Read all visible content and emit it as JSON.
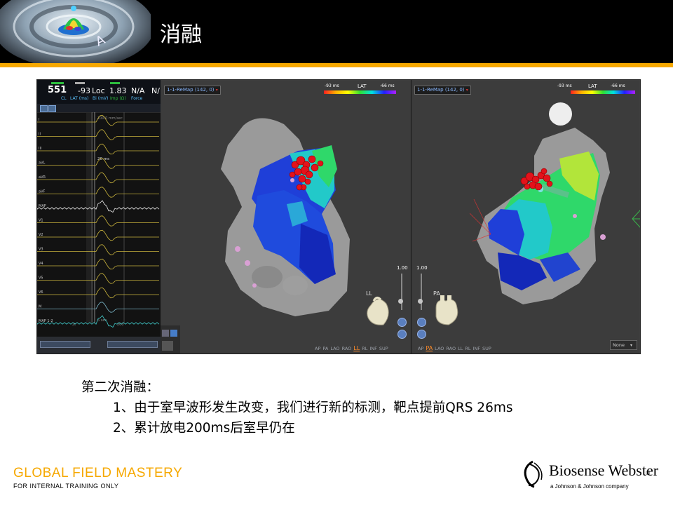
{
  "slide": {
    "title": "消融",
    "body_heading": "第二次消融：",
    "body_line_1": "1、由于室早波形发生改变，我们进行新的标测，靶点提前QRS 26ms",
    "body_line_2": "2、累计放电200ms后室早仍在"
  },
  "footer": {
    "program": "GLOBAL  FIELD  MASTERY",
    "disclaimer": "FOR INTERNAL  TRAINING  ONLY",
    "brand": "Biosense Webster",
    "brand_mark": "®",
    "brand_sub": "a Johnson & Johnson company"
  },
  "ecg": {
    "readouts": [
      {
        "value": "551",
        "label": "CL"
      },
      {
        "value": "-93",
        "label": "LAT (ms)"
      },
      {
        "value": "Loc",
        "label": "Bi (mV)"
      },
      {
        "value": "1.83",
        "label": "Imp (Ω)"
      },
      {
        "value": "N/A",
        "label": "Force"
      },
      {
        "value": "N/",
        "label": ""
      }
    ],
    "speed_label": "100.0 mm/sec",
    "interval_label": "26 ms",
    "time_label_left": "2t",
    "time_label_mid": "5 sec",
    "time_label_right": "200",
    "leads": [
      "I",
      "II",
      "III",
      "aVL",
      "aVR",
      "aVF",
      "MAP",
      "V1",
      "V2",
      "V3",
      "V4",
      "V5",
      "V6",
      "M",
      "MAP 1-2"
    ]
  },
  "map_left": {
    "map_selector": "1-1-ReMap (142, 0)",
    "lat_title": "LAT",
    "lat_min": "-93 ms",
    "lat_max": "-66 ms",
    "slider_value": "1.00",
    "orientation": "LL",
    "views": [
      "AP",
      "PA",
      "LAO",
      "RAO",
      "LL",
      "RL",
      "INF",
      "SUP"
    ],
    "active_view": "LL"
  },
  "map_right": {
    "map_selector": "1-1-ReMap (142, 0)",
    "lat_title": "LAT",
    "lat_min": "-93 ms",
    "lat_max": "-66 ms",
    "slider_value": "1.00",
    "orientation": "PA",
    "views": [
      "AP",
      "PA",
      "LAO",
      "RAO",
      "LL",
      "RL",
      "INF",
      "SUP"
    ],
    "active_view": "PA",
    "dropdown": "None",
    "axis_label": "R"
  }
}
